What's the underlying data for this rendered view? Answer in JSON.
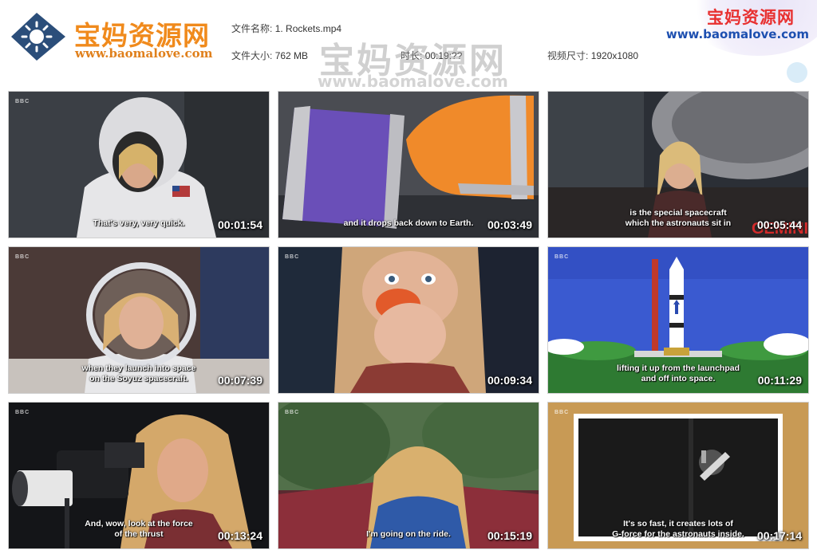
{
  "header": {
    "brand_cn": "宝妈资源网",
    "brand_url": "www.baomalove.com",
    "file_name_label": "文件名称:",
    "file_name": "1. Rockets.mp4",
    "file_size_label": "文件大小:",
    "file_size": "762 MB",
    "duration_label": "时长:",
    "duration": "00:19:??",
    "resolution_label": "视频尺寸:",
    "resolution": "1920x1080",
    "corner_cn": "宝妈资源网",
    "corner_url": "www.baomalove.com",
    "watermark_cn": "宝妈资源网",
    "watermark_url": "www.baomalove.com"
  },
  "thumbnails": [
    {
      "subtitle": [
        "That's very, very quick."
      ],
      "time": "00:01:54",
      "scene": "astronaut-cutout"
    },
    {
      "subtitle": [
        "and it drops back down to Earth."
      ],
      "time": "00:03:49",
      "scene": "paper-rockets"
    },
    {
      "subtitle": [
        "is the special spacecraft",
        "which the astronauts sit in"
      ],
      "time": "00:05:44",
      "scene": "museum-spacecraft"
    },
    {
      "subtitle": [
        "when they launch into space",
        "on the Soyuz spacecraft."
      ],
      "time": "00:07:39",
      "scene": "helmet"
    },
    {
      "subtitle": [],
      "time": "00:09:34",
      "scene": "balloon"
    },
    {
      "subtitle": [
        "lifting it up from the launchpad",
        "and off into space."
      ],
      "time": "00:11:29",
      "scene": "cartoon-rocket"
    },
    {
      "subtitle": [
        "And, wow, look at the force",
        "of the thrust"
      ],
      "time": "00:13:24",
      "scene": "camera"
    },
    {
      "subtitle": [
        "I'm going on the ride."
      ],
      "time": "00:15:19",
      "scene": "ride"
    },
    {
      "subtitle": [
        "It's so fast, it creates lots of",
        "G-force for the astronauts inside."
      ],
      "time": "00:17:14",
      "scene": "spaceship-frame"
    }
  ],
  "channel_bug": "BBC",
  "colors": {
    "brand_orange": "#f08a1c",
    "corner_red": "#e83030",
    "corner_blue": "#1d4fb0"
  }
}
